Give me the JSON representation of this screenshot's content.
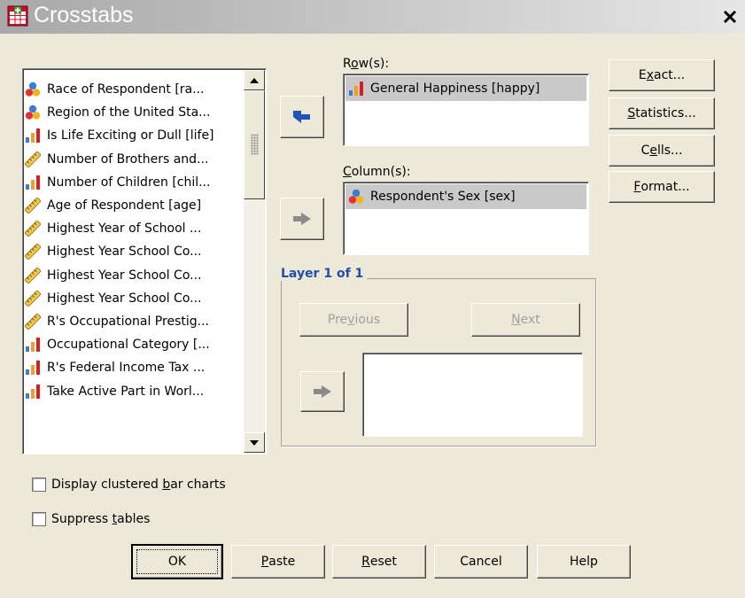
{
  "window": {
    "title": "Crosstabs"
  },
  "source_list": {
    "items": [
      {
        "label": "Race of Respondent [ra...",
        "icon": "nominal-icon"
      },
      {
        "label": "Region of the United Sta...",
        "icon": "nominal-icon"
      },
      {
        "label": "Is Life Exciting or Dull [life]",
        "icon": "ordinal-icon"
      },
      {
        "label": "Number of Brothers and...",
        "icon": "scale-icon"
      },
      {
        "label": "Number of Children [chil...",
        "icon": "ordinal-icon"
      },
      {
        "label": "Age of Respondent [age]",
        "icon": "scale-icon"
      },
      {
        "label": "Highest Year of School ...",
        "icon": "scale-icon"
      },
      {
        "label": "Highest Year School Co...",
        "icon": "scale-icon"
      },
      {
        "label": "Highest Year School Co...",
        "icon": "scale-icon"
      },
      {
        "label": "Highest Year School Co...",
        "icon": "scale-icon"
      },
      {
        "label": "R's Occupational Prestig...",
        "icon": "scale-icon"
      },
      {
        "label": "Occupational Category [...",
        "icon": "ordinal-icon"
      },
      {
        "label": "R's Federal Income Tax ...",
        "icon": "ordinal-icon"
      },
      {
        "label": "Take Active Part in Worl...",
        "icon": "ordinal-icon"
      }
    ]
  },
  "rows": {
    "label_pre": "R",
    "label_ul": "o",
    "label_post": "w(s):",
    "item": "General Happiness [happy]"
  },
  "columns": {
    "label_pre": "",
    "label_ul": "C",
    "label_post": "olumn(s):",
    "item": "Respondent's Sex [sex]"
  },
  "layer": {
    "title": "Layer 1 of 1",
    "previous": {
      "pre": "Pre",
      "ul": "v",
      "post": "ious"
    },
    "next": {
      "pre": "",
      "ul": "N",
      "post": "ext"
    }
  },
  "side_buttons": {
    "exact": {
      "pre": "E",
      "ul": "x",
      "post": "act..."
    },
    "statistics": {
      "pre": "",
      "ul": "S",
      "post": "tatistics..."
    },
    "cells": {
      "pre": "C",
      "ul": "e",
      "post": "lls..."
    },
    "format": {
      "pre": "",
      "ul": "F",
      "post": "ormat..."
    }
  },
  "options": {
    "clustered": {
      "pre": "Display clustered ",
      "ul": "b",
      "post": "ar charts",
      "checked": false
    },
    "suppress": {
      "pre": "Suppress ",
      "ul": "t",
      "post": "ables",
      "checked": false
    }
  },
  "bottom_buttons": {
    "ok": "OK",
    "paste": {
      "pre": "",
      "ul": "P",
      "post": "aste"
    },
    "reset": {
      "pre": "",
      "ul": "R",
      "post": "eset"
    },
    "cancel": "Cancel",
    "help": "Help"
  },
  "colors": {
    "accent": "#3a6ec8",
    "group_title": "#1f4ea8",
    "selected_item_bg": "#c9c9c9"
  }
}
